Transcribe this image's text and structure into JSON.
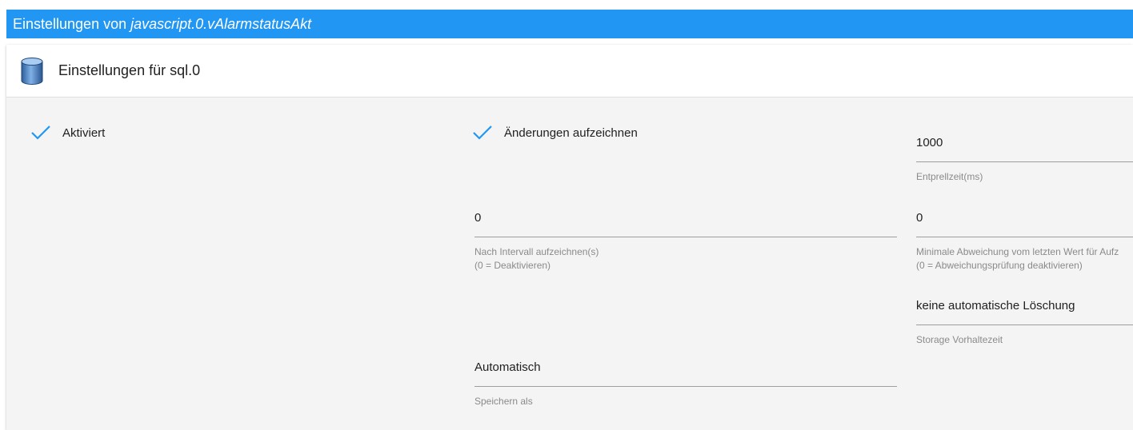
{
  "dialog": {
    "title_prefix": "Einstellungen von ",
    "title_object": "javascript.0.vAlarmstatusAkt"
  },
  "panel": {
    "title": "Einstellungen für sql.0",
    "icon": "database-icon"
  },
  "settings": {
    "enabled_label": "Aktiviert",
    "record_changes_label": "Änderungen aufzeichnen",
    "debounce": {
      "value": "1000",
      "hint": "Entprellzeit(ms)"
    },
    "interval": {
      "value": "0",
      "hint_line1": "Nach Intervall aufzeichnen(s)",
      "hint_line2": "(0 = Deaktivieren)"
    },
    "min_deviation": {
      "value": "0",
      "hint_line1": "Minimale Abweichung vom letzten Wert für Aufz",
      "hint_line2": "(0 = Abweichungsprüfung deaktivieren)"
    },
    "retention": {
      "value": "keine automatische Löschung",
      "hint": "Storage Vorhaltezeit"
    },
    "store_as": {
      "value": "Automatisch",
      "hint": "Speichern als"
    }
  },
  "colors": {
    "accent": "#2196f3",
    "panel_bg": "#f4f4f4"
  }
}
